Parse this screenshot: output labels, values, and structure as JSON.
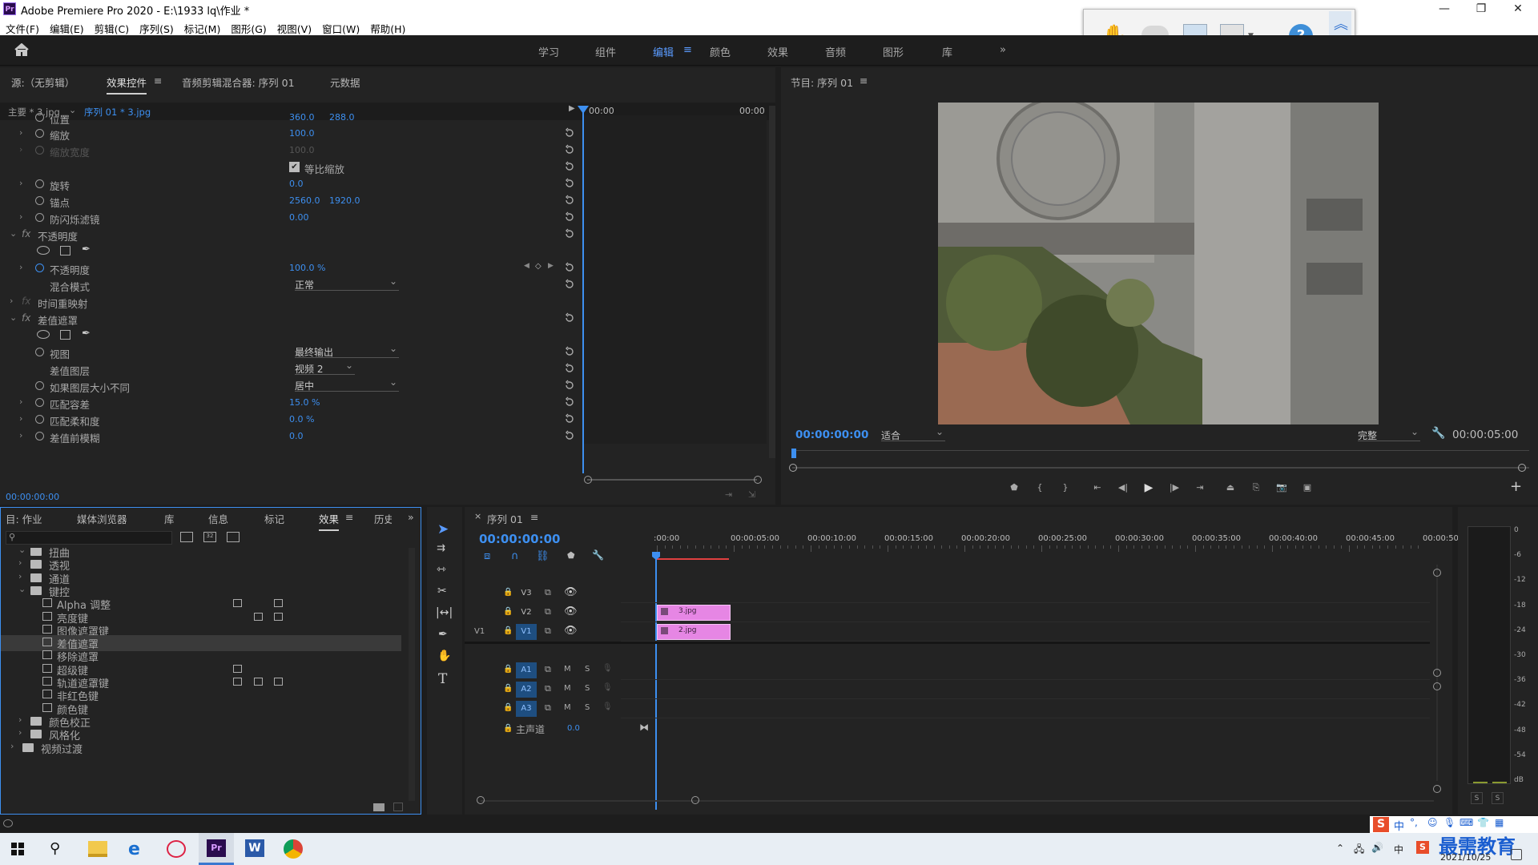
{
  "window": {
    "title": "Adobe Premiere Pro 2020 - E:\\1933 lq\\作业 *",
    "logo": "Pr"
  },
  "menu": [
    "文件(F)",
    "编辑(E)",
    "剪辑(C)",
    "序列(S)",
    "标记(M)",
    "图形(G)",
    "视图(V)",
    "窗口(W)",
    "帮助(H)"
  ],
  "workspaces": [
    {
      "label": "学习",
      "active": false
    },
    {
      "label": "组件",
      "active": false
    },
    {
      "label": "编辑",
      "active": true
    },
    {
      "label": "颜色",
      "active": false
    },
    {
      "label": "效果",
      "active": false
    },
    {
      "label": "音频",
      "active": false
    },
    {
      "label": "图形",
      "active": false
    },
    {
      "label": "库",
      "active": false
    }
  ],
  "source_panel": {
    "tabs": [
      "源:（无剪辑）",
      "效果控件",
      "音频剪辑混合器: 序列 01",
      "元数据"
    ],
    "active_tab": "效果控件",
    "master_label": "主要 * 3.jpg",
    "clip_label": "序列 01 * 3.jpg",
    "timecode_left": "00:00",
    "timecode_right": "00:00",
    "footer_time": "00:00:00:00",
    "rows": {
      "position": {
        "label": "位置",
        "v1": "360.0",
        "v2": "288.0"
      },
      "scale": {
        "label": "缩放",
        "v1": "100.0"
      },
      "scale_width": {
        "label": "缩放宽度",
        "v1": "100.0"
      },
      "uniform_scale": {
        "label": "等比缩放"
      },
      "rotation": {
        "label": "旋转",
        "v1": "0.0"
      },
      "anchor": {
        "label": "锚点",
        "v1": "2560.0",
        "v2": "1920.0"
      },
      "antiflicker": {
        "label": "防闪烁滤镜",
        "v1": "0.00"
      },
      "opacity_group": {
        "label": "不透明度"
      },
      "opacity": {
        "label": "不透明度",
        "v1": "100.0 %"
      },
      "blend": {
        "label": "混合模式",
        "value": "正常"
      },
      "time_remap": {
        "label": "时间重映射"
      },
      "diff_matte": {
        "label": "差值遮罩"
      },
      "view": {
        "label": "视图",
        "value": "最终输出"
      },
      "diff_layer": {
        "label": "差值图层",
        "value": "视频 2"
      },
      "layer_size": {
        "label": "如果图层大小不同",
        "value": "居中"
      },
      "match_tol": {
        "label": "匹配容差",
        "v1": "15.0 %"
      },
      "match_soft": {
        "label": "匹配柔和度",
        "v1": "0.0 %"
      },
      "pre_blur": {
        "label": "差值前模糊",
        "v1": "0.0"
      }
    }
  },
  "program_panel": {
    "title": "节目: 序列 01",
    "timecode": "00:00:00:00",
    "fit": "适合",
    "quality": "完整",
    "duration": "00:00:05:00"
  },
  "effects_panel": {
    "tabs": [
      "目: 作业",
      "媒体浏览器",
      "库",
      "信息",
      "标记",
      "效果",
      "历史"
    ],
    "active_tab": "效果",
    "tree": [
      {
        "label": "扭曲",
        "type": "folder",
        "level": 1,
        "open": true
      },
      {
        "label": "透视",
        "type": "folder",
        "level": 1,
        "open": false
      },
      {
        "label": "通道",
        "type": "folder",
        "level": 1,
        "open": false
      },
      {
        "label": "键控",
        "type": "folder",
        "level": 1,
        "open": true
      },
      {
        "label": "Alpha 调整",
        "type": "preset",
        "level": 2,
        "badges": 2
      },
      {
        "label": "亮度键",
        "type": "preset",
        "level": 2,
        "badges": 2
      },
      {
        "label": "图像遮罩键",
        "type": "preset",
        "level": 2,
        "badges": 0
      },
      {
        "label": "差值遮罩",
        "type": "preset",
        "level": 2,
        "badges": 0,
        "selected": true
      },
      {
        "label": "移除遮罩",
        "type": "preset",
        "level": 2,
        "badges": 0
      },
      {
        "label": "超级键",
        "type": "preset",
        "level": 2,
        "badges": 1
      },
      {
        "label": "轨道遮罩键",
        "type": "preset",
        "level": 2,
        "badges": 3
      },
      {
        "label": "非红色键",
        "type": "preset",
        "level": 2,
        "badges": 0
      },
      {
        "label": "颜色键",
        "type": "preset",
        "level": 2,
        "badges": 0
      },
      {
        "label": "颜色校正",
        "type": "folder",
        "level": 1,
        "open": false
      },
      {
        "label": "风格化",
        "type": "folder",
        "level": 1,
        "open": false
      },
      {
        "label": "视频过渡",
        "type": "folder",
        "level": 0,
        "open": false
      }
    ]
  },
  "timeline": {
    "title": "序列 01",
    "timecode": "00:00:00:00",
    "ruler": [
      ":00:00",
      "00:00:05:00",
      "00:00:10:00",
      "00:00:15:00",
      "00:00:20:00",
      "00:00:25:00",
      "00:00:30:00",
      "00:00:35:00",
      "00:00:40:00",
      "00:00:45:00",
      "00:00:50"
    ],
    "video_tracks": [
      {
        "name": "V3",
        "clip": ""
      },
      {
        "name": "V2",
        "clip": "3.jpg"
      },
      {
        "name": "V1",
        "clip": "2.jpg",
        "src": "V1"
      }
    ],
    "audio_tracks": [
      "A1",
      "A2",
      "A3"
    ],
    "master": {
      "label": "主声道",
      "value": "0.0"
    },
    "track_letters": {
      "m": "M",
      "s": "S"
    }
  },
  "meter": {
    "scale": [
      "0",
      "-6",
      "-12",
      "-18",
      "-24",
      "-30",
      "-36",
      "-42",
      "-48",
      "-54",
      "dB"
    ],
    "solo": [
      "S",
      "S"
    ]
  },
  "taskbar": {
    "date": "2021/10/25",
    "ime": "中",
    "watermark": "最需教育"
  }
}
